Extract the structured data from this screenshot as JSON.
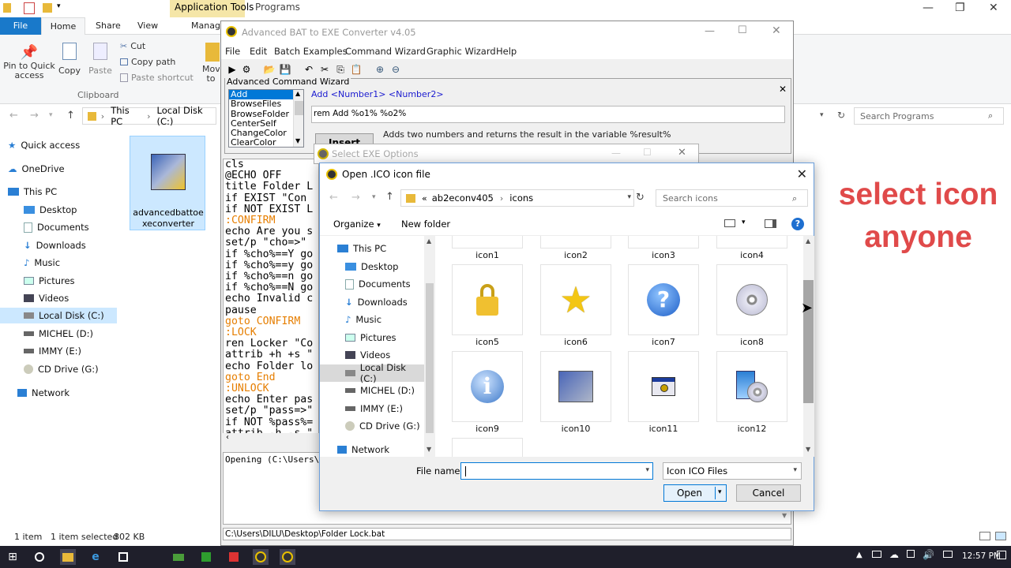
{
  "explorer": {
    "context_tab": "Application Tools",
    "context_tab2": "Programs",
    "tabs": [
      "File",
      "Home",
      "Share",
      "View",
      "Manag"
    ],
    "ribbon": {
      "pin": "Pin to Quick access",
      "copy": "Copy",
      "paste": "Paste",
      "cut": "Cut",
      "copy_path": "Copy path",
      "paste_shortcut": "Paste shortcut",
      "move": "Mov to",
      "group_clipboard": "Clipboard"
    },
    "breadcrumb": [
      "This PC",
      "Local Disk (C:)"
    ],
    "search_placeholder": "Search Programs",
    "nav": [
      "Quick access",
      "OneDrive",
      "This PC",
      "Desktop",
      "Documents",
      "Downloads",
      "Music",
      "Pictures",
      "Videos",
      "Local Disk (C:)",
      "MICHEL (D:)",
      "IMMY (E:)",
      "CD Drive (G:)",
      "Network"
    ],
    "file_name": "advancedbattoexeconverter",
    "status_items": "1 item",
    "status_selected": "1 item selected",
    "status_size": "802 KB"
  },
  "converter": {
    "title": "Advanced BAT to EXE Converter v4.05",
    "menu": [
      "File",
      "Edit",
      "Batch Examples",
      "Command Wizard",
      "Graphic Wizard",
      "Help"
    ],
    "wizard_label": "Advanced Command Wizard",
    "commands": [
      "Add",
      "BrowseFiles",
      "BrowseFolder",
      "CenterSelf",
      "ChangeColor",
      "ClearColor"
    ],
    "signature": "Add <Number1> <Number2>",
    "input_value": "rem Add %o1% %o2%",
    "insert_btn": "Insert CMD",
    "description": "Adds two numbers and returns the result in the variable %result%",
    "code": [
      {
        "t": "cls",
        "k": false
      },
      {
        "t": "@ECHO OFF",
        "k": false
      },
      {
        "t": "title Folder L",
        "k": false
      },
      {
        "t": "if EXIST \"Con",
        "k": false
      },
      {
        "t": "if NOT EXIST L",
        "k": false
      },
      {
        "t": ":CONFIRM",
        "k": true
      },
      {
        "t": "echo Are you s",
        "k": false
      },
      {
        "t": "set/p \"cho=>\"",
        "k": false
      },
      {
        "t": "if %cho%==Y go",
        "k": false
      },
      {
        "t": "if %cho%==y go",
        "k": false
      },
      {
        "t": "if %cho%==n go",
        "k": false
      },
      {
        "t": "if %cho%==N go",
        "k": false
      },
      {
        "t": "echo Invalid c",
        "k": false
      },
      {
        "t": "pause",
        "k": false
      },
      {
        "t": "goto CONFIRM",
        "k": true
      },
      {
        "t": ":LOCK",
        "k": true
      },
      {
        "t": "ren Locker \"Co",
        "k": false
      },
      {
        "t": "attrib +h +s \"",
        "k": false
      },
      {
        "t": "echo Folder lo",
        "k": false
      },
      {
        "t": "goto End",
        "k": true
      },
      {
        "t": ":UNLOCK",
        "k": true
      },
      {
        "t": "echo Enter pas",
        "k": false
      },
      {
        "t": "set/p \"pass=>\"",
        "k": false
      },
      {
        "t": "if NOT %pass%=",
        "k": false
      },
      {
        "t": "attrib -h -s \"",
        "k": false
      }
    ],
    "output": "Opening (C:\\Users\\D",
    "path": "C:\\Users\\DILU\\Desktop\\Folder Lock.bat"
  },
  "exe_options": {
    "title": "Select EXE Options"
  },
  "dialog": {
    "title": "Open .ICO icon file",
    "breadcrumb_prefix": "«",
    "breadcrumb": [
      "ab2econv405",
      "icons"
    ],
    "search_placeholder": "Search icons",
    "organize": "Organize",
    "new_folder": "New folder",
    "nav": [
      "This PC",
      "Desktop",
      "Documents",
      "Downloads",
      "Music",
      "Pictures",
      "Videos",
      "Local Disk (C:)",
      "MICHEL (D:)",
      "IMMY (E:)",
      "CD Drive (G:)",
      "Network"
    ],
    "icons": [
      "icon1",
      "icon2",
      "icon3",
      "icon4",
      "icon5",
      "icon6",
      "icon7",
      "icon8",
      "icon9",
      "icon10",
      "icon11",
      "icon12"
    ],
    "file_name_label": "File name:",
    "file_name_value": "",
    "file_type": "Icon ICO Files",
    "open_btn": "Open",
    "cancel_btn": "Cancel"
  },
  "caption": {
    "line1": "select icon",
    "line2": "anyone"
  },
  "taskbar": {
    "time": "12:57 PM"
  }
}
